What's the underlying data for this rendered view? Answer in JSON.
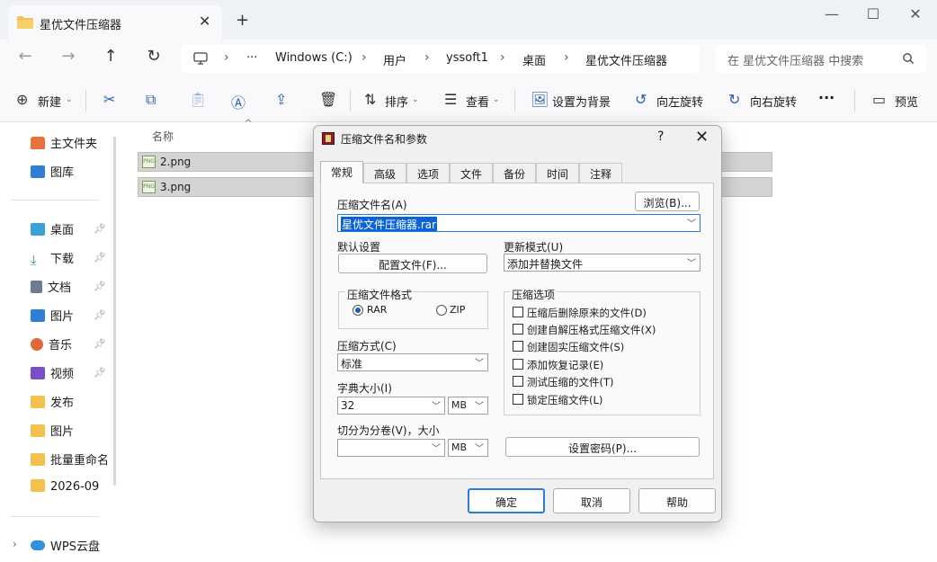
{
  "window": {
    "tab_title": "星优文件压缩器",
    "tab_close": "✕",
    "new_tab": "+",
    "minimize": "—",
    "maximize": "☐",
    "close": "✕"
  },
  "address": {
    "crumbs": [
      "Windows (C:)",
      "用户",
      "yssoft1",
      "桌面",
      "星优文件压缩器"
    ],
    "ellipsis": "···",
    "search_placeholder": "在 星优文件压缩器 中搜索"
  },
  "toolbar": {
    "new_label": "新建",
    "sort_label": "排序",
    "view_label": "查看",
    "set_bg_label": "设置为背景",
    "rotate_left_label": "向左旋转",
    "rotate_right_label": "向右旋转",
    "more_label": "···",
    "preview_label": "预览"
  },
  "sidebar": {
    "items": [
      {
        "label": "主文件夹",
        "icon": "home-icon",
        "color": "#e8733a"
      },
      {
        "label": "图库",
        "icon": "gallery-icon",
        "color": "#2f7fd4"
      },
      {
        "label": "桌面",
        "icon": "desktop-icon",
        "color": "#3aa0d8"
      },
      {
        "label": "下载",
        "icon": "download-icon",
        "color": "#1f9a5a"
      },
      {
        "label": "文档",
        "icon": "document-icon",
        "color": "#6b7c93"
      },
      {
        "label": "图片",
        "icon": "pictures-icon",
        "color": "#2f7fd4"
      },
      {
        "label": "音乐",
        "icon": "music-icon",
        "color": "#e0673a"
      },
      {
        "label": "视频",
        "icon": "video-icon",
        "color": "#7c4fc9"
      },
      {
        "label": "发布",
        "icon": "folder-icon",
        "color": "#f2c14e"
      },
      {
        "label": "图片",
        "icon": "folder-icon",
        "color": "#f2c14e"
      },
      {
        "label": "批量重命名",
        "icon": "folder-icon",
        "color": "#f2c14e"
      },
      {
        "label": "2026-09",
        "icon": "folder-icon",
        "color": "#f2c14e"
      },
      {
        "label": "WPS云盘",
        "icon": "cloud-icon",
        "color": "#2f8fe0"
      }
    ]
  },
  "files": {
    "column_name": "名称",
    "rows": [
      {
        "name": "2.png",
        "badge": "PNG"
      },
      {
        "name": "3.png",
        "badge": "PNG"
      }
    ]
  },
  "dialog": {
    "title": "压缩文件名和参数",
    "help": "?",
    "close": "✕",
    "tabs": [
      "常规",
      "高级",
      "选项",
      "文件",
      "备份",
      "时间",
      "注释"
    ],
    "archive_name_label": "压缩文件名(A)",
    "browse_button": "浏览(B)...",
    "archive_name_value": "星优文件压缩器.rar",
    "default_settings_label": "默认设置",
    "config_button": "配置文件(F)...",
    "update_mode_label": "更新模式(U)",
    "update_mode_value": "添加并替换文件",
    "format_group_label": "压缩文件格式",
    "format_rar": "RAR",
    "format_zip": "ZIP",
    "method_label": "压缩方式(C)",
    "method_value": "标准",
    "dict_label": "字典大小(I)",
    "dict_value": "32",
    "dict_unit": "MB",
    "split_label": "切分为分卷(V)，大小",
    "split_unit": "MB",
    "options_group_label": "压缩选项",
    "options": [
      "压缩后删除原来的文件(D)",
      "创建自解压格式压缩文件(X)",
      "创建固实压缩文件(S)",
      "添加恢复记录(E)",
      "测试压缩的文件(T)",
      "锁定压缩文件(L)"
    ],
    "password_button": "设置密码(P)...",
    "ok_button": "确定",
    "cancel_button": "取消",
    "help_button": "帮助"
  }
}
